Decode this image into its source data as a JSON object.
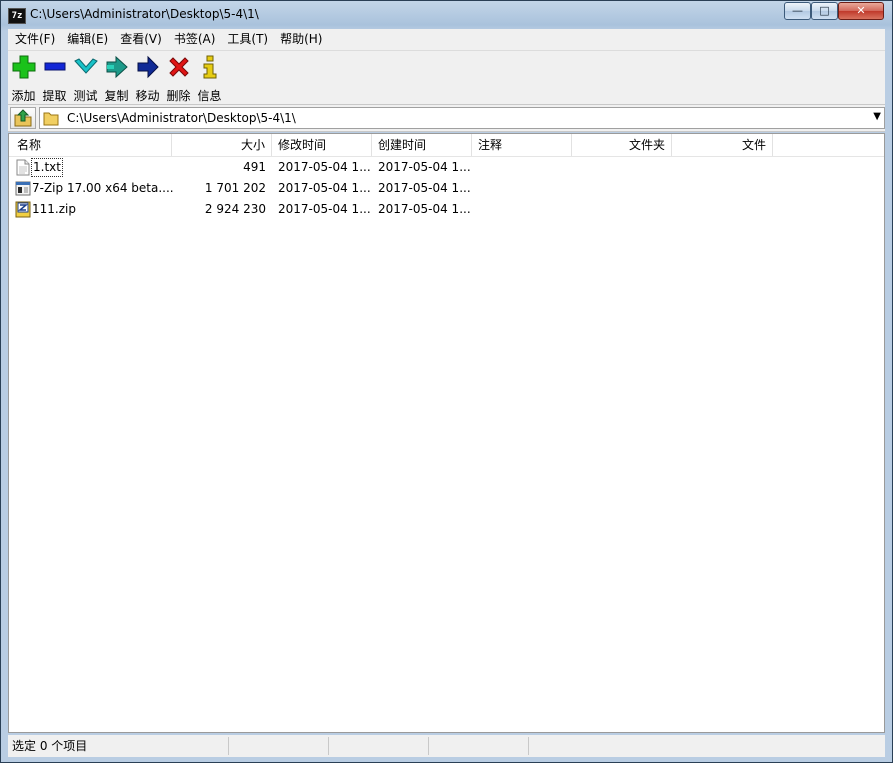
{
  "window": {
    "title": "C:\\Users\\Administrator\\Desktop\\5-4\\1\\",
    "app_icon_text": "7z",
    "controls": {
      "minimize": "—",
      "maximize": "□",
      "close": "✕"
    }
  },
  "menu": [
    {
      "label": "文件(F)"
    },
    {
      "label": "编辑(E)"
    },
    {
      "label": "查看(V)"
    },
    {
      "label": "书签(A)"
    },
    {
      "label": "工具(T)"
    },
    {
      "label": "帮助(H)"
    }
  ],
  "toolbar": [
    {
      "label": "添加",
      "icon": "plus-icon",
      "color": "#1bc21b"
    },
    {
      "label": "提取",
      "icon": "minus-icon",
      "color": "#1226d6"
    },
    {
      "label": "测试",
      "icon": "checkmark-icon",
      "color": "#18c2c8"
    },
    {
      "label": "复制",
      "icon": "double-arrow-icon",
      "color": "#1d9a8a"
    },
    {
      "label": "移动",
      "icon": "arrow-right-icon",
      "color": "#102a96"
    },
    {
      "label": "删除",
      "icon": "x-icon",
      "color": "#e01515"
    },
    {
      "label": "信息",
      "icon": "info-icon",
      "color": "#e6cc12"
    }
  ],
  "address": {
    "path": "C:\\Users\\Administrator\\Desktop\\5-4\\1\\",
    "dropdown_icon": "chevron-down-icon"
  },
  "columns": [
    "名称",
    "大小",
    "修改时间",
    "创建时间",
    "注释",
    "文件夹",
    "文件"
  ],
  "files": [
    {
      "name": "1.txt",
      "size": "491",
      "modified": "2017-05-04 1...",
      "created": "2017-05-04 1...",
      "comment": "",
      "folders": "",
      "files": "",
      "icon": "text-file-icon"
    },
    {
      "name": "7-Zip 17.00 x64 beta....",
      "size": "1 701 202",
      "modified": "2017-05-04 1...",
      "created": "2017-05-04 1...",
      "comment": "",
      "folders": "",
      "files": "",
      "icon": "executable-file-icon"
    },
    {
      "name": "111.zip",
      "size": "2 924 230",
      "modified": "2017-05-04 1...",
      "created": "2017-05-04 1...",
      "comment": "",
      "folders": "",
      "files": "",
      "icon": "zip-archive-icon"
    }
  ],
  "status": {
    "selected": "选定 0 个项目",
    "cell2": "",
    "cell3": "",
    "cell4": ""
  }
}
